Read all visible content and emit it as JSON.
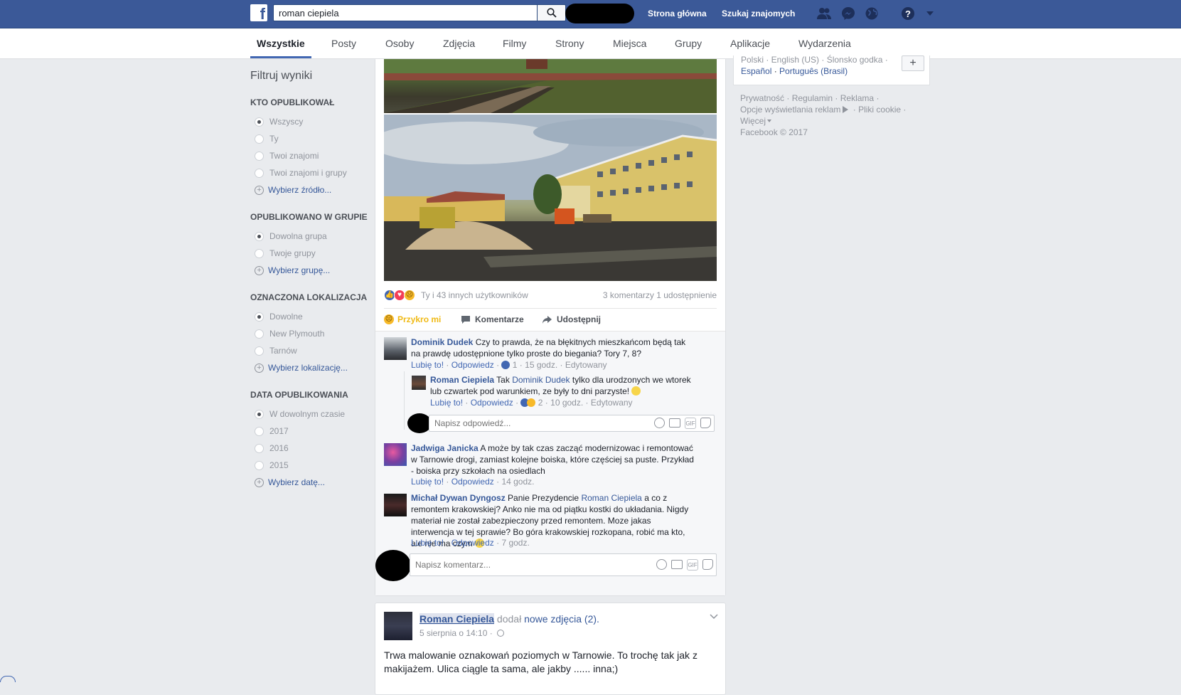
{
  "topbar": {
    "logo": "f",
    "search_value": "roman ciepiela",
    "nav_home": "Strona główna",
    "nav_find_friends": "Szukaj znajomych"
  },
  "tabs": [
    {
      "label": "Wszystkie",
      "active": true
    },
    {
      "label": "Posty"
    },
    {
      "label": "Osoby"
    },
    {
      "label": "Zdjęcia"
    },
    {
      "label": "Filmy"
    },
    {
      "label": "Strony"
    },
    {
      "label": "Miejsca"
    },
    {
      "label": "Grupy"
    },
    {
      "label": "Aplikacje"
    },
    {
      "label": "Wydarzenia"
    }
  ],
  "sidebar": {
    "title": "Filtruj wyniki",
    "groups": [
      {
        "heading": "KTO OPUBLIKOWAŁ",
        "options": [
          "Wszyscy",
          "Ty",
          "Twoi znajomi",
          "Twoi znajomi i grupy"
        ],
        "selected": 0,
        "link": "Wybierz źródło..."
      },
      {
        "heading": "OPUBLIKOWANO W GRUPIE",
        "options": [
          "Dowolna grupa",
          "Twoje grupy"
        ],
        "selected": 0,
        "link": "Wybierz grupę..."
      },
      {
        "heading": "OZNACZONA LOKALIZACJA",
        "options": [
          "Dowolne",
          "New Plymouth",
          "Tarnów"
        ],
        "selected": 0,
        "link": "Wybierz lokalizację..."
      },
      {
        "heading": "DATA OPUBLIKOWANIA",
        "options": [
          "W dowolnym czasie",
          "2017",
          "2016",
          "2015"
        ],
        "selected": 0,
        "link": "Wybierz datę..."
      }
    ]
  },
  "post1": {
    "reactions_text": "Ty i 43 innych użytkowników",
    "counts_text": "3 komentarzy  1 udostępnienie",
    "actions": {
      "react": "Przykro mi",
      "comment": "Komentarze",
      "share": "Udostępnij"
    },
    "comments": [
      {
        "name": "Dominik Dudek",
        "text": "Czy to prawda, że na błękitnych mieszkańcom będą tak na prawdę udostępnione tylko proste do biegania? Tory 7, 8?",
        "like": "Lubię to!",
        "reply": "Odpowiedz",
        "count": "1",
        "time": "15 godz.",
        "edited": "Edytowany"
      },
      {
        "name": "Roman Ciepiela",
        "prefix": "Tak",
        "mention": "Dominik Dudek",
        "text": "tylko dla urodzonych we wtorek lub czwartek pod warunkiem, ze były to dni parzyste!",
        "like": "Lubię to!",
        "reply": "Odpowiedz",
        "count": "2",
        "time": "10 godz.",
        "edited": "Edytowany"
      },
      {
        "name": "Jadwiga Janicka",
        "text": "A może by tak czas zacząć modernizowac i remontować w Tarnowie drogi, zamiast kolejne boiska, które częściej sa puste. Przykład - boiska przy szkołach na osiedlach",
        "like": "Lubię to!",
        "reply": "Odpowiedz",
        "time": "14 godz."
      },
      {
        "name": "Michał Dywan Dyngosz",
        "prefix": "Panie Prezydencie",
        "mention": "Roman Ciepiela",
        "text": "a co z remontem krakowskiej? Anko nie ma od piątku kostki do układania. Nigdy materiał nie został zabezpieczony przed remontem. Moze jakas interwencja w tej sprawie? Bo góra krakowskiej rozkopana, robić ma kto, ale nie ma czym",
        "like": "Lubię to!",
        "reply": "Odpowiedz",
        "time": "7 godz."
      }
    ],
    "reply_placeholder": "Napisz odpowiedź...",
    "comment_placeholder": "Napisz komentarz..."
  },
  "post2": {
    "author": "Roman Ciepiela",
    "action": "dodał",
    "action_link": "nowe zdjęcia (2).",
    "date": "5 sierpnia o 14:10 ·",
    "text": "Trwa malowanie oznakowań poziomych w Tarnowie. To trochę tak jak z makijażem. Ulica ciągle ta sama, ale jakby ...... inna;)"
  },
  "right": {
    "langs_line1": "Polski · English (US) · Ślonsko godka ·",
    "langs_line2_a": "Español",
    "langs_line2_b": "Português (Brasil)",
    "add_lang": "+",
    "footer": {
      "privacy": "Prywatność",
      "terms": "Regulamin",
      "ads": "Reklama",
      "ad_choices": "Opcje wyświetlania reklam",
      "cookies": "Pliki cookie",
      "more": "Więcej",
      "copyright": "Facebook © 2017"
    }
  },
  "colors": {
    "brand": "#3b5998",
    "link": "#365899",
    "sad": "#f0ba15"
  }
}
